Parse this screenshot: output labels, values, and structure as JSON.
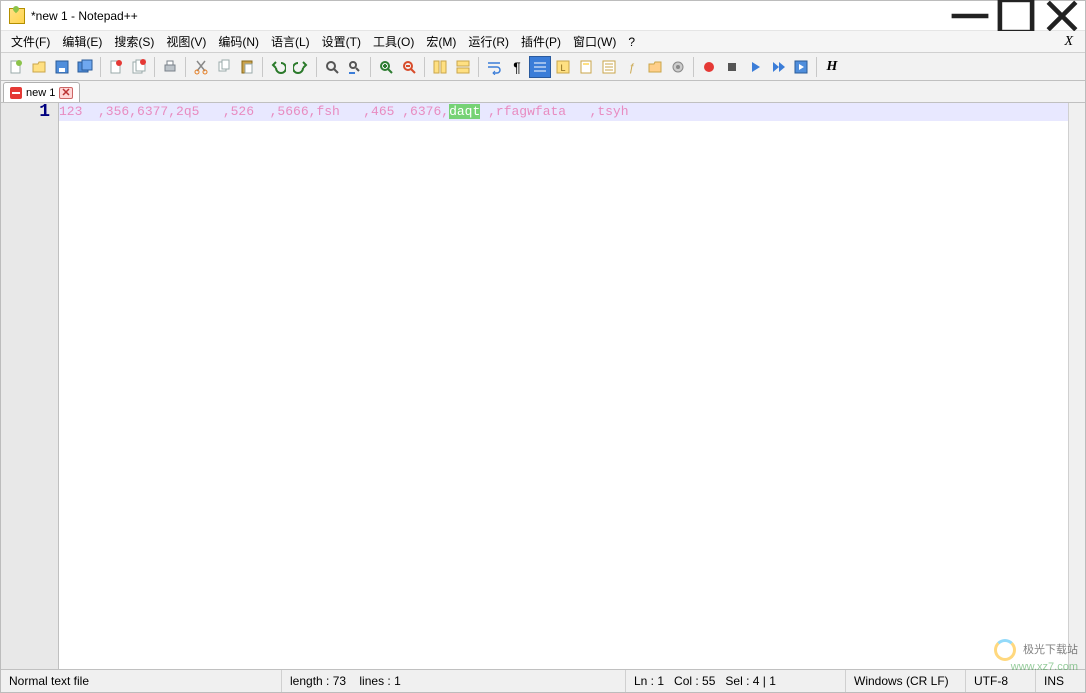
{
  "window": {
    "title": "*new 1 - Notepad++"
  },
  "menu": {
    "items": [
      "文件(F)",
      "编辑(E)",
      "搜索(S)",
      "视图(V)",
      "编码(N)",
      "语言(L)",
      "设置(T)",
      "工具(O)",
      "宏(M)",
      "运行(R)",
      "插件(P)",
      "窗口(W)",
      "?"
    ],
    "right": "X"
  },
  "tabs": [
    {
      "label": "new 1"
    }
  ],
  "editor": {
    "line_number": "1",
    "segments": [
      {
        "t": "123  ,356,6377,2q5   ,526  ,5666,fsh   ,465 ,6376,",
        "sel": false
      },
      {
        "t": "daqt",
        "sel": true
      },
      {
        "t": " ,rfagwfata   ,tsyh",
        "sel": false
      }
    ]
  },
  "status": {
    "filetype": "Normal text file",
    "length": "length : 73",
    "lines": "lines : 1",
    "ln": "Ln : 1",
    "col": "Col : 55",
    "sel": "Sel : 4 | 1",
    "eol": "Windows (CR LF)",
    "enc": "UTF-8",
    "ins": "INS"
  },
  "watermark": {
    "brand": "极光下载站",
    "url": "www.xz7.com"
  }
}
